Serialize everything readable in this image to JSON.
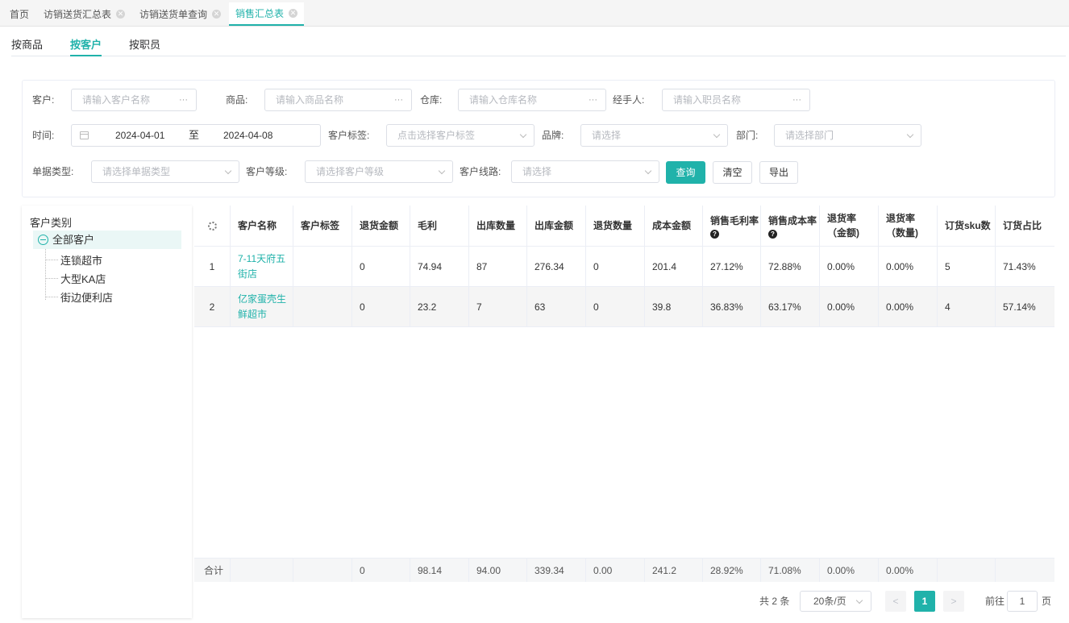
{
  "tabs": [
    {
      "label": "首页",
      "closable": false,
      "active": false
    },
    {
      "label": "访销送货汇总表",
      "closable": true,
      "active": false
    },
    {
      "label": "访销送货单查询",
      "closable": true,
      "active": false
    },
    {
      "label": "销售汇总表",
      "closable": true,
      "active": true
    }
  ],
  "subtabs": [
    {
      "label": "按商品",
      "active": false
    },
    {
      "label": "按客户",
      "active": true
    },
    {
      "label": "按职员",
      "active": false
    }
  ],
  "filters": {
    "customer": {
      "label": "客户:",
      "placeholder": "请输入客户名称"
    },
    "product": {
      "label": "商品:",
      "placeholder": "请输入商品名称"
    },
    "warehouse": {
      "label": "仓库:",
      "placeholder": "请输入仓库名称"
    },
    "handler": {
      "label": "经手人:",
      "placeholder": "请输入职员名称"
    },
    "time": {
      "label": "时间:",
      "start": "2024-04-01",
      "separator": "至",
      "end": "2024-04-08"
    },
    "customer_tag": {
      "label": "客户标签:",
      "placeholder": "点击选择客户标签"
    },
    "brand": {
      "label": "品牌:",
      "placeholder": "请选择"
    },
    "department": {
      "label": "部门:",
      "placeholder": "请选择部门"
    },
    "doc_type": {
      "label": "单据类型:",
      "placeholder": "请选择单据类型"
    },
    "customer_level": {
      "label": "客户等级:",
      "placeholder": "请选择客户等级"
    },
    "customer_route": {
      "label": "客户线路:",
      "placeholder": "请选择"
    },
    "ellipsis": "···",
    "buttons": {
      "query": "查询",
      "clear": "清空",
      "export": "导出"
    }
  },
  "tree": {
    "title": "客户类别",
    "root": "全部客户",
    "children": [
      "连锁超市",
      "大型KA店",
      "街边便利店"
    ]
  },
  "table": {
    "headers": [
      "",
      "客户名称",
      "客户标签",
      "退货金额",
      "毛利",
      "出库数量",
      "出库金额",
      "退货数量",
      "成本金额",
      "销售毛利率",
      "销售成本率",
      "退货率（金额)",
      "退货率（数量)",
      "订货sku数",
      "订货占比"
    ],
    "help_mark": "?",
    "rows": [
      {
        "idx": "1",
        "name": "7-11天府五街店",
        "tag": "",
        "return_amount": "0",
        "gross_profit": "74.94",
        "out_qty": "87",
        "out_amount": "276.34",
        "return_qty": "0",
        "cost": "201.4",
        "margin_rate": "27.12%",
        "cost_rate": "72.88%",
        "return_rate_amount": "0.00%",
        "return_rate_qty": "0.00%",
        "sku": "5",
        "share": "71.43%"
      },
      {
        "idx": "2",
        "name": "亿家蛋壳生鲜超市",
        "tag": "",
        "return_amount": "0",
        "gross_profit": "23.2",
        "out_qty": "7",
        "out_amount": "63",
        "return_qty": "0",
        "cost": "39.8",
        "margin_rate": "36.83%",
        "cost_rate": "63.17%",
        "return_rate_amount": "0.00%",
        "return_rate_qty": "0.00%",
        "sku": "4",
        "share": "57.14%"
      }
    ],
    "summary": {
      "label": "合计",
      "return_amount": "0",
      "gross_profit": "98.14",
      "out_qty": "94.00",
      "out_amount": "339.34",
      "return_qty": "0.00",
      "cost": "241.2",
      "margin_rate": "28.92%",
      "cost_rate": "71.08%",
      "return_rate_amount": "0.00%",
      "return_rate_qty": "0.00%"
    }
  },
  "pagination": {
    "total": "共 2 条",
    "page_size": "20条/页",
    "prev": "<",
    "current": "1",
    "next": ">",
    "goto_label": "前往",
    "goto_value": "1",
    "goto_suffix": "页"
  },
  "colors": {
    "accent": "#20b2aa"
  }
}
